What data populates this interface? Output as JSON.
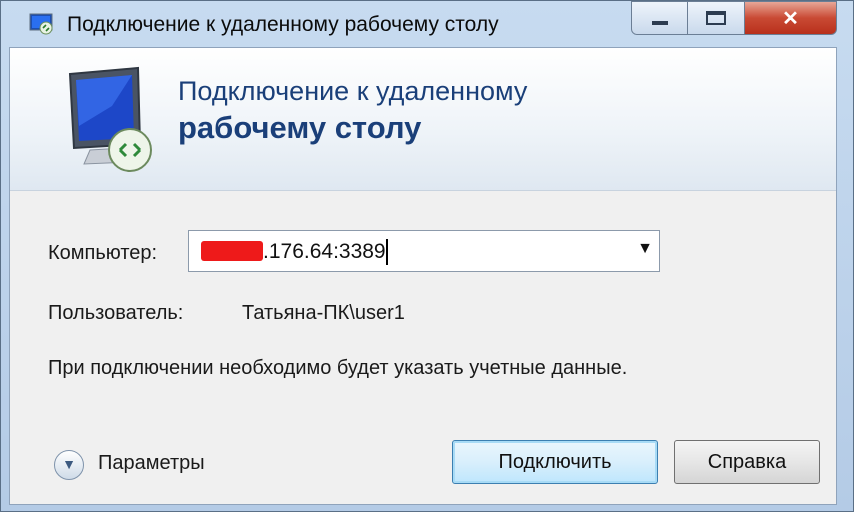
{
  "window": {
    "title": "Подключение к удаленному рабочему столу",
    "controls": {
      "minimize": "minimize",
      "maximize": "maximize",
      "close": "✕"
    }
  },
  "header": {
    "title_line1": "Подключение к удаленному",
    "title_line2": "рабочему столу"
  },
  "form": {
    "computer_label": "Компьютер:",
    "computer_value": ".176.64:3389",
    "computer_value_redacted": true,
    "user_label": "Пользователь:",
    "user_value": "Татьяна-ПК\\user1",
    "note": "При подключении необходимо будет указать учетные данные."
  },
  "footer": {
    "params_label": "Параметры",
    "connect_label": "Подключить",
    "help_label": "Справка"
  },
  "colors": {
    "title_blue": "#1a3f79",
    "redaction": "#ee1a1a",
    "close_red": "#c94a34"
  },
  "icons": [
    "rdp-title-icon",
    "rdp-monitor-icon",
    "chevron-down-icon",
    "expand-options-icon"
  ]
}
